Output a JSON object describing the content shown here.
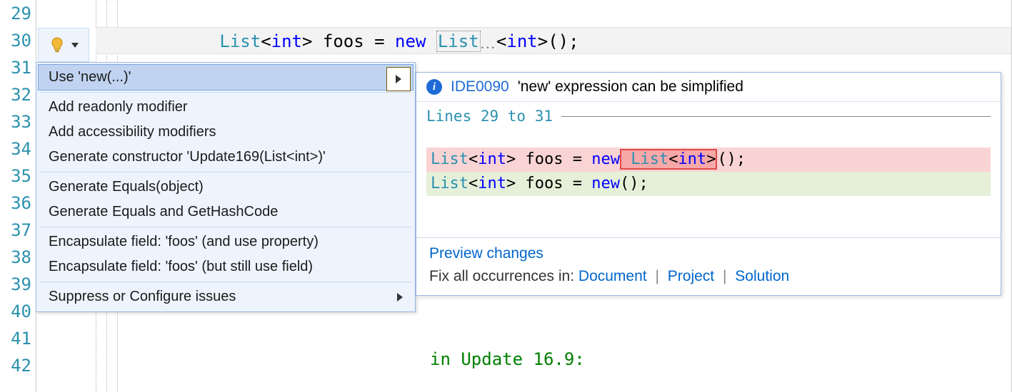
{
  "gutter": {
    "lines": [
      "29",
      "30",
      "31",
      "32",
      "33",
      "34",
      "35",
      "36",
      "37",
      "38",
      "39",
      "40",
      "41",
      "42"
    ]
  },
  "code": {
    "line30": {
      "indent": "            ",
      "t1": "List",
      "lt1": "<",
      "t2": "int",
      "gt1": ">",
      "var": " foos = ",
      "kw_new": "new",
      "sp": " ",
      "t3": "List",
      "lt2": "<",
      "t4": "int",
      "gt2": ">",
      "tail": "();"
    }
  },
  "menu": {
    "items": [
      "Use 'new(...)'",
      "Add readonly modifier",
      "Add accessibility modifiers",
      "Generate constructor 'Update169(List<int>)'",
      "Generate Equals(object)",
      "Generate Equals and GetHashCode",
      "Encapsulate field: 'foos' (and use property)",
      "Encapsulate field: 'foos' (but still use field)",
      "Suppress or Configure issues"
    ]
  },
  "preview": {
    "rule_id": "IDE0090",
    "rule_msg": "'new' expression can be simplified",
    "range_label": "Lines 29 to 31",
    "diff": {
      "del": {
        "a": "List",
        "lt1": "<",
        "b": "int",
        "gt1": ">",
        "c": " foos = ",
        "kw": "new",
        "hl_a": " List",
        "hl_lt": "<",
        "hl_b": "int",
        "hl_gt": ">",
        "tail": "();"
      },
      "add": {
        "a": "List",
        "lt1": "<",
        "b": "int",
        "gt1": ">",
        "c": " foos = ",
        "kw": "new",
        "tail": "();"
      }
    },
    "footer": {
      "preview_link": "Preview changes",
      "fix_label": "Fix all occurrences in: ",
      "scopes": [
        "Document",
        "Project",
        "Solution"
      ]
    }
  },
  "misc": {
    "stray_comment": "in Update 16.9:"
  }
}
